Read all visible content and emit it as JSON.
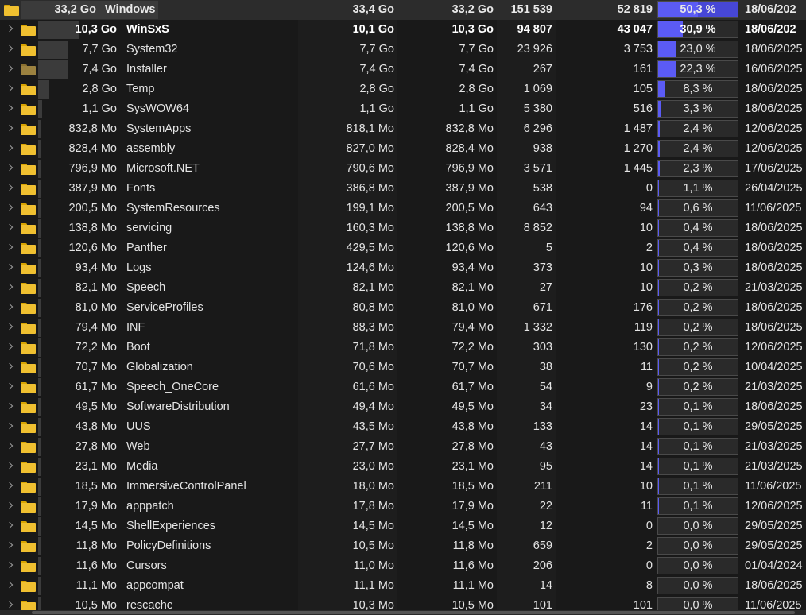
{
  "colors": {
    "background": "#191919",
    "root_row": "#2c2c2c",
    "percent_fill": "#5b5bf5",
    "size_bar": "#3b3b3b",
    "folder": "#f0c030"
  },
  "icons": {
    "expand": "chevron-right-icon",
    "folder": "folder-icon"
  },
  "root": {
    "size": "33,2 Go",
    "name": "Windows",
    "allocated": "33,4 Go",
    "size2": "33,2 Go",
    "files": "151 539",
    "folders": "52 819",
    "percent_label": "50,3 %",
    "percent": 50.3,
    "date": "18/06/202"
  },
  "rows": [
    {
      "size": "10,3 Go",
      "name": "WinSxS",
      "allocated": "10,1 Go",
      "size2": "10,3 Go",
      "files": "94 807",
      "folders": "43 047",
      "percent_label": "30,9 %",
      "percent": 30.9,
      "date": "18/06/202",
      "selected": true
    },
    {
      "size": "7,7 Go",
      "name": "System32",
      "allocated": "7,7 Go",
      "size2": "7,7 Go",
      "files": "23 926",
      "folders": "3 753",
      "percent_label": "23,0 %",
      "percent": 23.0,
      "date": "18/06/2025"
    },
    {
      "size": "7,4 Go",
      "name": "Installer",
      "allocated": "7,4 Go",
      "size2": "7,4 Go",
      "files": "267",
      "folders": "161",
      "percent_label": "22,3 %",
      "percent": 22.3,
      "date": "16/06/2025",
      "dim": true
    },
    {
      "size": "2,8 Go",
      "name": "Temp",
      "allocated": "2,8 Go",
      "size2": "2,8 Go",
      "files": "1 069",
      "folders": "105",
      "percent_label": "8,3 %",
      "percent": 8.3,
      "date": "18/06/2025"
    },
    {
      "size": "1,1 Go",
      "name": "SysWOW64",
      "allocated": "1,1 Go",
      "size2": "1,1 Go",
      "files": "5 380",
      "folders": "516",
      "percent_label": "3,3 %",
      "percent": 3.3,
      "date": "18/06/2025"
    },
    {
      "size": "832,8 Mo",
      "name": "SystemApps",
      "allocated": "818,1 Mo",
      "size2": "832,8 Mo",
      "files": "6 296",
      "folders": "1 487",
      "percent_label": "2,4 %",
      "percent": 2.4,
      "date": "12/06/2025"
    },
    {
      "size": "828,4 Mo",
      "name": "assembly",
      "allocated": "827,0 Mo",
      "size2": "828,4 Mo",
      "files": "938",
      "folders": "1 270",
      "percent_label": "2,4 %",
      "percent": 2.4,
      "date": "12/06/2025"
    },
    {
      "size": "796,9 Mo",
      "name": "Microsoft.NET",
      "allocated": "790,6 Mo",
      "size2": "796,9 Mo",
      "files": "3 571",
      "folders": "1 445",
      "percent_label": "2,3 %",
      "percent": 2.3,
      "date": "17/06/2025"
    },
    {
      "size": "387,9 Mo",
      "name": "Fonts",
      "allocated": "386,8 Mo",
      "size2": "387,9 Mo",
      "files": "538",
      "folders": "0",
      "percent_label": "1,1 %",
      "percent": 1.1,
      "date": "26/04/2025"
    },
    {
      "size": "200,5 Mo",
      "name": "SystemResources",
      "allocated": "199,1 Mo",
      "size2": "200,5 Mo",
      "files": "643",
      "folders": "94",
      "percent_label": "0,6 %",
      "percent": 0.6,
      "date": "11/06/2025"
    },
    {
      "size": "138,8 Mo",
      "name": "servicing",
      "allocated": "160,3 Mo",
      "size2": "138,8 Mo",
      "files": "8 852",
      "folders": "10",
      "percent_label": "0,4 %",
      "percent": 0.4,
      "date": "18/06/2025"
    },
    {
      "size": "120,6 Mo",
      "name": "Panther",
      "allocated": "429,5 Mo",
      "size2": "120,6 Mo",
      "files": "5",
      "folders": "2",
      "percent_label": "0,4 %",
      "percent": 0.4,
      "date": "18/06/2025"
    },
    {
      "size": "93,4 Mo",
      "name": "Logs",
      "allocated": "124,6 Mo",
      "size2": "93,4 Mo",
      "files": "373",
      "folders": "10",
      "percent_label": "0,3 %",
      "percent": 0.3,
      "date": "18/06/2025"
    },
    {
      "size": "82,1 Mo",
      "name": "Speech",
      "allocated": "82,1 Mo",
      "size2": "82,1 Mo",
      "files": "27",
      "folders": "10",
      "percent_label": "0,2 %",
      "percent": 0.2,
      "date": "21/03/2025"
    },
    {
      "size": "81,0 Mo",
      "name": "ServiceProfiles",
      "allocated": "80,8 Mo",
      "size2": "81,0 Mo",
      "files": "671",
      "folders": "176",
      "percent_label": "0,2 %",
      "percent": 0.2,
      "date": "18/06/2025"
    },
    {
      "size": "79,4 Mo",
      "name": "INF",
      "allocated": "88,3 Mo",
      "size2": "79,4 Mo",
      "files": "1 332",
      "folders": "119",
      "percent_label": "0,2 %",
      "percent": 0.2,
      "date": "18/06/2025"
    },
    {
      "size": "72,2 Mo",
      "name": "Boot",
      "allocated": "71,8 Mo",
      "size2": "72,2 Mo",
      "files": "303",
      "folders": "130",
      "percent_label": "0,2 %",
      "percent": 0.2,
      "date": "12/06/2025"
    },
    {
      "size": "70,7 Mo",
      "name": "Globalization",
      "allocated": "70,6 Mo",
      "size2": "70,7 Mo",
      "files": "38",
      "folders": "11",
      "percent_label": "0,2 %",
      "percent": 0.2,
      "date": "10/04/2025"
    },
    {
      "size": "61,7 Mo",
      "name": "Speech_OneCore",
      "allocated": "61,6 Mo",
      "size2": "61,7 Mo",
      "files": "54",
      "folders": "9",
      "percent_label": "0,2 %",
      "percent": 0.2,
      "date": "21/03/2025"
    },
    {
      "size": "49,5 Mo",
      "name": "SoftwareDistribution",
      "allocated": "49,4 Mo",
      "size2": "49,5 Mo",
      "files": "34",
      "folders": "23",
      "percent_label": "0,1 %",
      "percent": 0.1,
      "date": "18/06/2025"
    },
    {
      "size": "43,8 Mo",
      "name": "UUS",
      "allocated": "43,5 Mo",
      "size2": "43,8 Mo",
      "files": "133",
      "folders": "14",
      "percent_label": "0,1 %",
      "percent": 0.1,
      "date": "29/05/2025"
    },
    {
      "size": "27,8 Mo",
      "name": "Web",
      "allocated": "27,7 Mo",
      "size2": "27,8 Mo",
      "files": "43",
      "folders": "14",
      "percent_label": "0,1 %",
      "percent": 0.1,
      "date": "21/03/2025"
    },
    {
      "size": "23,1 Mo",
      "name": "Media",
      "allocated": "23,0 Mo",
      "size2": "23,1 Mo",
      "files": "95",
      "folders": "14",
      "percent_label": "0,1 %",
      "percent": 0.1,
      "date": "21/03/2025"
    },
    {
      "size": "18,5 Mo",
      "name": "ImmersiveControlPanel",
      "allocated": "18,0 Mo",
      "size2": "18,5 Mo",
      "files": "211",
      "folders": "10",
      "percent_label": "0,1 %",
      "percent": 0.1,
      "date": "11/06/2025"
    },
    {
      "size": "17,9 Mo",
      "name": "apppatch",
      "allocated": "17,8 Mo",
      "size2": "17,9 Mo",
      "files": "22",
      "folders": "11",
      "percent_label": "0,1 %",
      "percent": 0.1,
      "date": "12/06/2025"
    },
    {
      "size": "14,5 Mo",
      "name": "ShellExperiences",
      "allocated": "14,5 Mo",
      "size2": "14,5 Mo",
      "files": "12",
      "folders": "0",
      "percent_label": "0,0 %",
      "percent": 0.0,
      "date": "29/05/2025"
    },
    {
      "size": "11,8 Mo",
      "name": "PolicyDefinitions",
      "allocated": "10,5 Mo",
      "size2": "11,8 Mo",
      "files": "659",
      "folders": "2",
      "percent_label": "0,0 %",
      "percent": 0.0,
      "date": "29/05/2025"
    },
    {
      "size": "11,6 Mo",
      "name": "Cursors",
      "allocated": "11,0 Mo",
      "size2": "11,6 Mo",
      "files": "206",
      "folders": "0",
      "percent_label": "0,0 %",
      "percent": 0.0,
      "date": "01/04/2024"
    },
    {
      "size": "11,1 Mo",
      "name": "appcompat",
      "allocated": "11,1 Mo",
      "size2": "11,1 Mo",
      "files": "14",
      "folders": "8",
      "percent_label": "0,0 %",
      "percent": 0.0,
      "date": "18/06/2025"
    },
    {
      "size": "10,5 Mo",
      "name": "rescache",
      "allocated": "10,3 Mo",
      "size2": "10,5 Mo",
      "files": "101",
      "folders": "101",
      "percent_label": "0,0 %",
      "percent": 0.0,
      "date": "11/06/2025"
    }
  ]
}
